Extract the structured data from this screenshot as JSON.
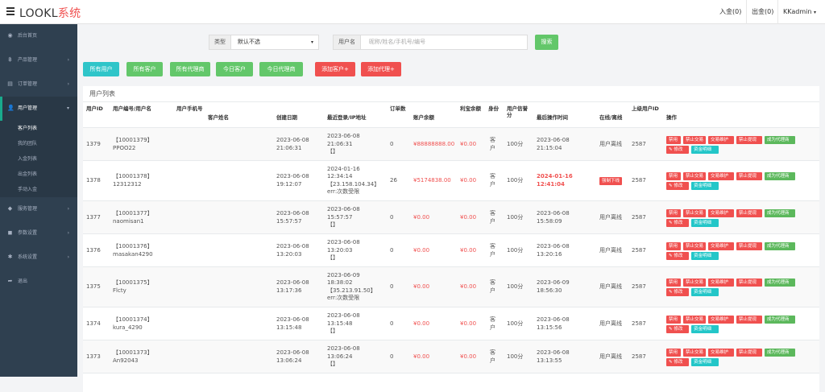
{
  "app": {
    "brand_main": "LOOKL",
    "brand_sys": "系统"
  },
  "topbar": {
    "deposit": "入金(0)",
    "withdraw": "出金(0)",
    "user": "KKadmin",
    "user_caret": "▾"
  },
  "sidebar": {
    "items": [
      {
        "icon": "dashboard-icon",
        "glyph": "◉",
        "label": "后台首页",
        "arrow": ""
      },
      {
        "icon": "product-icon",
        "glyph": "฿",
        "label": "产品管理",
        "arrow": "›"
      },
      {
        "icon": "order-icon",
        "glyph": "▤",
        "label": "订单管理",
        "arrow": "›"
      },
      {
        "icon": "user-icon",
        "glyph": "👤",
        "label": "用户管理",
        "arrow": "▾"
      },
      {
        "icon": "service-icon",
        "glyph": "◆",
        "label": "服务管理",
        "arrow": "›"
      },
      {
        "icon": "params-icon",
        "glyph": "◼",
        "label": "参数设置",
        "arrow": "›"
      },
      {
        "icon": "settings-icon",
        "glyph": "✱",
        "label": "系统设置",
        "arrow": "›"
      },
      {
        "icon": "logout-icon",
        "glyph": "➦",
        "label": "退出",
        "arrow": ""
      }
    ],
    "sub": [
      "客户列表",
      "我的团队",
      "入金列表",
      "出金列表",
      "手动入金"
    ]
  },
  "filters": {
    "type_label": "类型",
    "type_value": "默认不选",
    "username_label": "用户名",
    "username_placeholder": "昵称/姓名/手机号/编号",
    "search": "搜索"
  },
  "quick": [
    "所有用户",
    "所有客户",
    "所有代理商",
    "今日客户",
    "今日代理商",
    "添加客户+",
    "添加代理+"
  ],
  "panel_title": "用户列表",
  "headers": [
    "用户ID",
    "用户编号/用户名",
    "用户手机号",
    "客户姓名",
    "创建日期",
    "最近登录/IP地址",
    "订单数",
    "账户余额",
    "利宝余额",
    "身份",
    "用户信誉分",
    "最后操作时间",
    "在线/离线",
    "上级用户ID",
    "操作"
  ],
  "actions": {
    "ban": "禁用",
    "ban_trade": "禁止交易",
    "trade_maint": "交易维护",
    "ban_withdraw": "禁止提现",
    "to_agent": "成为代理商",
    "edit": "✎ 修改",
    "funds": "资金明细",
    "force_offline": "强制下线"
  },
  "rows": [
    {
      "id": "1379",
      "code": "【10001379】",
      "name": "PPOO22",
      "created": [
        "2023-06-08",
        "21:06:31"
      ],
      "login": [
        "2023-06-08",
        "21:06:31",
        "【】"
      ],
      "orders": "0",
      "balance": "¥88888888.00",
      "lb": "¥0.00",
      "role": [
        "客",
        "户"
      ],
      "credit": "100分",
      "last": [
        "2023-06-08",
        "21:15:04"
      ],
      "last_red": false,
      "status": "用户离线",
      "forced": false,
      "parent": "2587"
    },
    {
      "id": "1378",
      "code": "【10001378】",
      "name": "12312312",
      "created": [
        "2023-06-08",
        "19:12:07"
      ],
      "login": [
        "2024-01-16",
        "12:34:14",
        "【23.158.104.34】",
        "err:次数受限"
      ],
      "orders": "26",
      "balance": "¥5174838.00",
      "lb": "¥0.00",
      "role": [
        "客",
        "户"
      ],
      "credit": "100分",
      "last": [
        "2024-01-16",
        "12:41:04"
      ],
      "last_red": true,
      "status": "",
      "forced": true,
      "parent": "2587"
    },
    {
      "id": "1377",
      "code": "【10001377】",
      "name": "naomisan1",
      "created": [
        "2023-06-08",
        "15:57:57"
      ],
      "login": [
        "2023-06-08",
        "15:57:57",
        "【】"
      ],
      "orders": "0",
      "balance": "¥0.00",
      "lb": "¥0.00",
      "role": [
        "客",
        "户"
      ],
      "credit": "100分",
      "last": [
        "2023-06-08",
        "15:58:09"
      ],
      "last_red": false,
      "status": "用户离线",
      "forced": false,
      "parent": "2587"
    },
    {
      "id": "1376",
      "code": "【10001376】",
      "name": "masakan4290",
      "created": [
        "2023-06-08",
        "13:20:03"
      ],
      "login": [
        "2023-06-08",
        "13:20:03",
        "【】"
      ],
      "orders": "0",
      "balance": "¥0.00",
      "lb": "¥0.00",
      "role": [
        "客",
        "户"
      ],
      "credit": "100分",
      "last": [
        "2023-06-08",
        "13:20:16"
      ],
      "last_red": false,
      "status": "用户离线",
      "forced": false,
      "parent": "2587"
    },
    {
      "id": "1375",
      "code": "【10001375】",
      "name": "Flcty",
      "created": [
        "2023-06-08",
        "13:17:36"
      ],
      "login": [
        "2023-06-09",
        "18:38:02",
        "【35.213.91.50】",
        "err:次数受限"
      ],
      "orders": "0",
      "balance": "¥0.00",
      "lb": "¥0.00",
      "role": [
        "客",
        "户"
      ],
      "credit": "100分",
      "last": [
        "2023-06-09",
        "18:56:30"
      ],
      "last_red": false,
      "status": "用户离线",
      "forced": false,
      "parent": "2587"
    },
    {
      "id": "1374",
      "code": "【10001374】",
      "name": "kura_4290",
      "created": [
        "2023-06-08",
        "13:15:48"
      ],
      "login": [
        "2023-06-08",
        "13:15:48",
        "【】"
      ],
      "orders": "0",
      "balance": "¥0.00",
      "lb": "¥0.00",
      "role": [
        "客",
        "户"
      ],
      "credit": "100分",
      "last": [
        "2023-06-08",
        "13:15:56"
      ],
      "last_red": false,
      "status": "用户离线",
      "forced": false,
      "parent": "2587"
    },
    {
      "id": "1373",
      "code": "【10001373】",
      "name": "An92043",
      "created": [
        "2023-06-08",
        "13:06:24"
      ],
      "login": [
        "2023-06-08",
        "13:06:24",
        "【】"
      ],
      "orders": "0",
      "balance": "¥0.00",
      "lb": "¥0.00",
      "role": [
        "客",
        "户"
      ],
      "credit": "100分",
      "last": [
        "2023-06-08",
        "13:13:55"
      ],
      "last_red": false,
      "status": "用户离线",
      "forced": false,
      "parent": "2587"
    }
  ]
}
